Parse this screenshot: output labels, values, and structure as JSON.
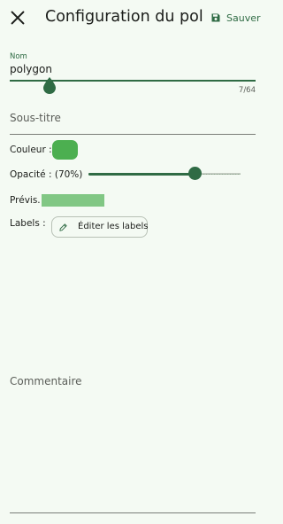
{
  "header": {
    "title": "Configuration du pol...",
    "save_label": "Sauver",
    "close_icon": "close-icon",
    "save_icon": "save-icon"
  },
  "name_field": {
    "label": "Nom",
    "value": "polygon",
    "counter": "7/64"
  },
  "subtitle_field": {
    "placeholder": "Sous-titre",
    "value": ""
  },
  "color_row": {
    "label": "Couleur :",
    "color": "#4caf50"
  },
  "opacity_row": {
    "label": "Opacité : (70%)",
    "value": 0.7
  },
  "preview_row": {
    "label": "Prévis.",
    "color": "#81c784"
  },
  "labels_row": {
    "label": "Labels :",
    "button_label": "Éditer les labels",
    "button_icon": "pencil-icon"
  },
  "comment_field": {
    "placeholder": "Commentaire",
    "value": ""
  },
  "theme": {
    "accent": "#2f6b44",
    "background": "#f4faf3"
  }
}
